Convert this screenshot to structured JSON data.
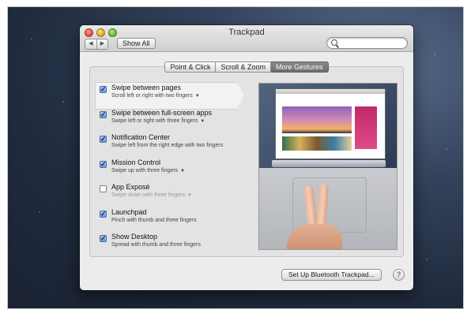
{
  "window": {
    "title": "Trackpad"
  },
  "toolbar": {
    "back_glyph": "◀",
    "forward_glyph": "▶",
    "show_all_label": "Show All",
    "search": {
      "value": "",
      "placeholder": ""
    }
  },
  "tabs": [
    {
      "label": "Point & Click",
      "selected": false
    },
    {
      "label": "Scroll & Zoom",
      "selected": false
    },
    {
      "label": "More Gestures",
      "selected": true
    }
  ],
  "gestures": [
    {
      "title": "Swipe between pages",
      "subtitle": "Scroll left or right with two fingers",
      "checked": true,
      "has_menu": true,
      "selected": true,
      "enabled": true
    },
    {
      "title": "Swipe between full-screen apps",
      "subtitle": "Swipe left or right with three fingers",
      "checked": true,
      "has_menu": true,
      "selected": false,
      "enabled": true
    },
    {
      "title": "Notification Center",
      "subtitle": "Swipe left from the right edge with two fingers",
      "checked": true,
      "has_menu": false,
      "selected": false,
      "enabled": true
    },
    {
      "title": "Mission Control",
      "subtitle": "Swipe up with three fingers",
      "checked": true,
      "has_menu": true,
      "selected": false,
      "enabled": true
    },
    {
      "title": "App Exposé",
      "subtitle": "Swipe down with three fingers",
      "checked": false,
      "has_menu": true,
      "selected": false,
      "enabled": false
    },
    {
      "title": "Launchpad",
      "subtitle": "Pinch with thumb and three fingers",
      "checked": true,
      "has_menu": false,
      "selected": false,
      "enabled": true
    },
    {
      "title": "Show Desktop",
      "subtitle": "Spread with thumb and three fingers",
      "checked": true,
      "has_menu": false,
      "selected": false,
      "enabled": true
    }
  ],
  "footer": {
    "setup_button_label": "Set Up Bluetooth Trackpad...",
    "help_label": "?"
  },
  "icons": {
    "close": "close-icon",
    "minimize": "minimize-icon",
    "zoom": "zoom-icon",
    "search": "search-icon",
    "checkmark": "✓",
    "menu_arrow": "▼"
  },
  "colors": {
    "window_bg": "#ececec",
    "selected_tab": "#6b6b6b",
    "checkbox_checked": "#6b9bd8"
  }
}
